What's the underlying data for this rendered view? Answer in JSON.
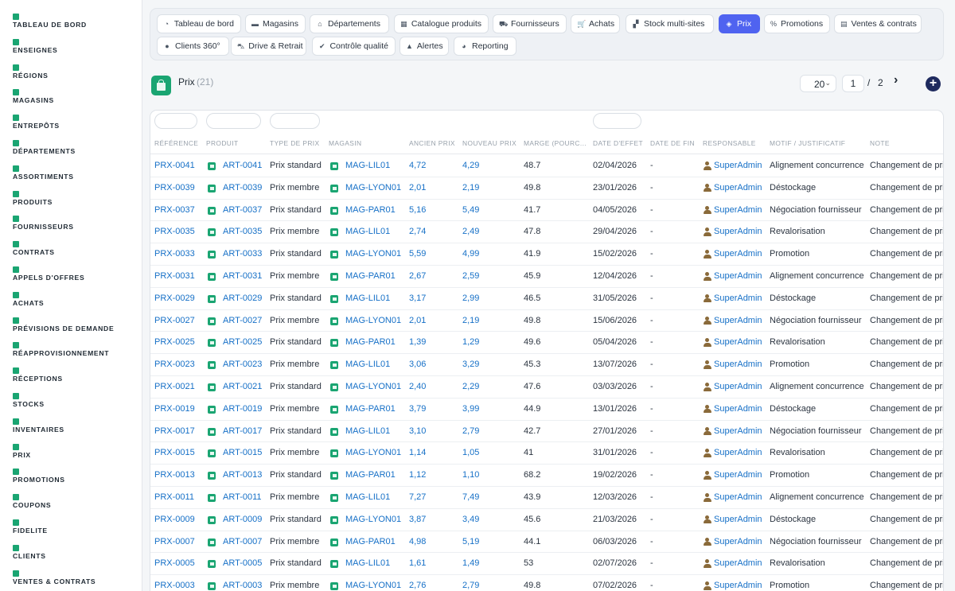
{
  "sidebar": {
    "items": [
      {
        "label": "TABLEAU DE BORD",
        "icon": "dashboard-icon"
      },
      {
        "label": "ENSEIGNES",
        "icon": "flag-icon"
      },
      {
        "label": "RÉGIONS",
        "icon": "map-icon"
      },
      {
        "label": "MAGASINS",
        "icon": "store-icon"
      },
      {
        "label": "ENTREPÔTS",
        "icon": "warehouse-icon"
      },
      {
        "label": "DÉPARTEMENTS",
        "icon": "sitemap-icon"
      },
      {
        "label": "ASSORTIMENTS",
        "icon": "list-icon"
      },
      {
        "label": "PRODUITS",
        "icon": "box-icon"
      },
      {
        "label": "FOURNISSEURS",
        "icon": "truck-icon"
      },
      {
        "label": "CONTRATS",
        "icon": "file-icon"
      },
      {
        "label": "APPELS D'OFFRES",
        "icon": "gavel-icon"
      },
      {
        "label": "ACHATS",
        "icon": "cart-icon"
      },
      {
        "label": "PRÉVISIONS DE DEMANDE",
        "icon": "chart-icon"
      },
      {
        "label": "RÉAPPROVISIONNEMENT",
        "icon": "sync-icon"
      },
      {
        "label": "RÉCEPTIONS",
        "icon": "dolly-icon"
      },
      {
        "label": "STOCKS",
        "icon": "stock-icon"
      },
      {
        "label": "INVENTAIRES",
        "icon": "clipboard-icon"
      },
      {
        "label": "PRIX",
        "icon": "tag-icon"
      },
      {
        "label": "PROMOTIONS",
        "icon": "percent-icon"
      },
      {
        "label": "COUPONS",
        "icon": "ticket-icon"
      },
      {
        "label": "FIDELITE",
        "icon": "card-icon"
      },
      {
        "label": "CLIENTS",
        "icon": "users-icon"
      },
      {
        "label": "VENTES & CONTRATS",
        "icon": "file-contract-icon"
      }
    ]
  },
  "tabs": [
    {
      "label": "Tableau de bord",
      "icon": "gauge-icon",
      "glyph": "◔",
      "active": false
    },
    {
      "label": "Magasins",
      "icon": "store-icon",
      "glyph": "▬",
      "active": false
    },
    {
      "label": "Départements",
      "icon": "building-icon",
      "glyph": "⌂",
      "active": false
    },
    {
      "label": "Catalogue produits",
      "icon": "grid-icon",
      "glyph": "▦",
      "active": false
    },
    {
      "label": "Fournisseurs",
      "icon": "truck-icon",
      "glyph": "⛟",
      "active": false
    },
    {
      "label": "Achats",
      "icon": "cart-icon",
      "glyph": "🛒",
      "active": false
    },
    {
      "label": "Stock multi-sites",
      "icon": "cubes-icon",
      "glyph": "▞",
      "active": false
    },
    {
      "label": "Prix",
      "icon": "tags-icon",
      "glyph": "◈",
      "active": true
    },
    {
      "label": "Promotions",
      "icon": "percent-icon",
      "glyph": "%",
      "active": false
    },
    {
      "label": "Ventes & contrats",
      "icon": "file-icon",
      "glyph": "▤",
      "active": false
    },
    {
      "label": "Clients 360°",
      "icon": "user-icon",
      "glyph": "●",
      "active": false
    },
    {
      "label": "Drive & Retrait",
      "icon": "car-icon",
      "glyph": "⛍",
      "active": false
    },
    {
      "label": "Contrôle qualité",
      "icon": "check-icon",
      "glyph": "✔",
      "active": false
    },
    {
      "label": "Alertes",
      "icon": "bell-icon",
      "glyph": "▲",
      "active": false
    },
    {
      "label": "Reporting",
      "icon": "pie-icon",
      "glyph": "◕",
      "active": false
    }
  ],
  "page": {
    "title": "Prix",
    "count": "(21)",
    "per_page": "20",
    "current_page": "1",
    "page_separator": "/",
    "total_pages": "2",
    "next_glyph": "›",
    "add_glyph": "+"
  },
  "columns": [
    "RÉFÉRENCE",
    "PRODUIT",
    "TYPE DE PRIX",
    "MAGASIN",
    "ANCIEN PRIX",
    "NOUVEAU PRIX",
    "MARGE (POURC...",
    "DATE D'EFFET",
    "DATE DE FIN",
    "RESPONSABLE",
    "MOTIF / JUSTIFICATIF",
    "NOTE"
  ],
  "rows": [
    {
      "ref": "PRX-0041",
      "produit": "ART-0041",
      "type": "Prix standard",
      "magasin": "MAG-LIL01",
      "ancien": "4,72",
      "nouveau": "4,29",
      "marge": "48.7",
      "effet": "02/04/2026",
      "fin": "-",
      "resp": "SuperAdmin",
      "motif": "Alignement concurrence",
      "note": "Changement de prix"
    },
    {
      "ref": "PRX-0039",
      "produit": "ART-0039",
      "type": "Prix membre",
      "magasin": "MAG-LYON01",
      "ancien": "2,01",
      "nouveau": "2,19",
      "marge": "49.8",
      "effet": "23/01/2026",
      "fin": "-",
      "resp": "SuperAdmin",
      "motif": "Déstockage",
      "note": "Changement de prix"
    },
    {
      "ref": "PRX-0037",
      "produit": "ART-0037",
      "type": "Prix standard",
      "magasin": "MAG-PAR01",
      "ancien": "5,16",
      "nouveau": "5,49",
      "marge": "41.7",
      "effet": "04/05/2026",
      "fin": "-",
      "resp": "SuperAdmin",
      "motif": "Négociation fournisseur",
      "note": "Changement de prix"
    },
    {
      "ref": "PRX-0035",
      "produit": "ART-0035",
      "type": "Prix membre",
      "magasin": "MAG-LIL01",
      "ancien": "2,74",
      "nouveau": "2,49",
      "marge": "47.8",
      "effet": "29/04/2026",
      "fin": "-",
      "resp": "SuperAdmin",
      "motif": "Revalorisation",
      "note": "Changement de prix"
    },
    {
      "ref": "PRX-0033",
      "produit": "ART-0033",
      "type": "Prix standard",
      "magasin": "MAG-LYON01",
      "ancien": "5,59",
      "nouveau": "4,99",
      "marge": "41.9",
      "effet": "15/02/2026",
      "fin": "-",
      "resp": "SuperAdmin",
      "motif": "Promotion",
      "note": "Changement de prix"
    },
    {
      "ref": "PRX-0031",
      "produit": "ART-0031",
      "type": "Prix membre",
      "magasin": "MAG-PAR01",
      "ancien": "2,67",
      "nouveau": "2,59",
      "marge": "45.9",
      "effet": "12/04/2026",
      "fin": "-",
      "resp": "SuperAdmin",
      "motif": "Alignement concurrence",
      "note": "Changement de prix"
    },
    {
      "ref": "PRX-0029",
      "produit": "ART-0029",
      "type": "Prix standard",
      "magasin": "MAG-LIL01",
      "ancien": "3,17",
      "nouveau": "2,99",
      "marge": "46.5",
      "effet": "31/05/2026",
      "fin": "-",
      "resp": "SuperAdmin",
      "motif": "Déstockage",
      "note": "Changement de prix"
    },
    {
      "ref": "PRX-0027",
      "produit": "ART-0027",
      "type": "Prix membre",
      "magasin": "MAG-LYON01",
      "ancien": "2,01",
      "nouveau": "2,19",
      "marge": "49.8",
      "effet": "15/06/2026",
      "fin": "-",
      "resp": "SuperAdmin",
      "motif": "Négociation fournisseur",
      "note": "Changement de prix"
    },
    {
      "ref": "PRX-0025",
      "produit": "ART-0025",
      "type": "Prix standard",
      "magasin": "MAG-PAR01",
      "ancien": "1,39",
      "nouveau": "1,29",
      "marge": "49.6",
      "effet": "05/04/2026",
      "fin": "-",
      "resp": "SuperAdmin",
      "motif": "Revalorisation",
      "note": "Changement de prix"
    },
    {
      "ref": "PRX-0023",
      "produit": "ART-0023",
      "type": "Prix membre",
      "magasin": "MAG-LIL01",
      "ancien": "3,06",
      "nouveau": "3,29",
      "marge": "45.3",
      "effet": "13/07/2026",
      "fin": "-",
      "resp": "SuperAdmin",
      "motif": "Promotion",
      "note": "Changement de prix"
    },
    {
      "ref": "PRX-0021",
      "produit": "ART-0021",
      "type": "Prix standard",
      "magasin": "MAG-LYON01",
      "ancien": "2,40",
      "nouveau": "2,29",
      "marge": "47.6",
      "effet": "03/03/2026",
      "fin": "-",
      "resp": "SuperAdmin",
      "motif": "Alignement concurrence",
      "note": "Changement de prix"
    },
    {
      "ref": "PRX-0019",
      "produit": "ART-0019",
      "type": "Prix membre",
      "magasin": "MAG-PAR01",
      "ancien": "3,79",
      "nouveau": "3,99",
      "marge": "44.9",
      "effet": "13/01/2026",
      "fin": "-",
      "resp": "SuperAdmin",
      "motif": "Déstockage",
      "note": "Changement de prix"
    },
    {
      "ref": "PRX-0017",
      "produit": "ART-0017",
      "type": "Prix standard",
      "magasin": "MAG-LIL01",
      "ancien": "3,10",
      "nouveau": "2,79",
      "marge": "42.7",
      "effet": "27/01/2026",
      "fin": "-",
      "resp": "SuperAdmin",
      "motif": "Négociation fournisseur",
      "note": "Changement de prix"
    },
    {
      "ref": "PRX-0015",
      "produit": "ART-0015",
      "type": "Prix membre",
      "magasin": "MAG-LYON01",
      "ancien": "1,14",
      "nouveau": "1,05",
      "marge": "41",
      "effet": "31/01/2026",
      "fin": "-",
      "resp": "SuperAdmin",
      "motif": "Revalorisation",
      "note": "Changement de prix"
    },
    {
      "ref": "PRX-0013",
      "produit": "ART-0013",
      "type": "Prix standard",
      "magasin": "MAG-PAR01",
      "ancien": "1,12",
      "nouveau": "1,10",
      "marge": "68.2",
      "effet": "19/02/2026",
      "fin": "-",
      "resp": "SuperAdmin",
      "motif": "Promotion",
      "note": "Changement de prix"
    },
    {
      "ref": "PRX-0011",
      "produit": "ART-0011",
      "type": "Prix membre",
      "magasin": "MAG-LIL01",
      "ancien": "7,27",
      "nouveau": "7,49",
      "marge": "43.9",
      "effet": "12/03/2026",
      "fin": "-",
      "resp": "SuperAdmin",
      "motif": "Alignement concurrence",
      "note": "Changement de prix"
    },
    {
      "ref": "PRX-0009",
      "produit": "ART-0009",
      "type": "Prix standard",
      "magasin": "MAG-LYON01",
      "ancien": "3,87",
      "nouveau": "3,49",
      "marge": "45.6",
      "effet": "21/03/2026",
      "fin": "-",
      "resp": "SuperAdmin",
      "motif": "Déstockage",
      "note": "Changement de prix"
    },
    {
      "ref": "PRX-0007",
      "produit": "ART-0007",
      "type": "Prix membre",
      "magasin": "MAG-PAR01",
      "ancien": "4,98",
      "nouveau": "5,19",
      "marge": "44.1",
      "effet": "06/03/2026",
      "fin": "-",
      "resp": "SuperAdmin",
      "motif": "Négociation fournisseur",
      "note": "Changement de prix"
    },
    {
      "ref": "PRX-0005",
      "produit": "ART-0005",
      "type": "Prix standard",
      "magasin": "MAG-LIL01",
      "ancien": "1,61",
      "nouveau": "1,49",
      "marge": "53",
      "effet": "02/07/2026",
      "fin": "-",
      "resp": "SuperAdmin",
      "motif": "Revalorisation",
      "note": "Changement de prix"
    },
    {
      "ref": "PRX-0003",
      "produit": "ART-0003",
      "type": "Prix membre",
      "magasin": "MAG-LYON01",
      "ancien": "2,76",
      "nouveau": "2,79",
      "marge": "49.8",
      "effet": "07/02/2026",
      "fin": "-",
      "resp": "SuperAdmin",
      "motif": "Promotion",
      "note": "Changement de prix"
    }
  ],
  "colors": {
    "accent": "#4f63f0",
    "brand_green": "#1aa572",
    "link": "#1670c7",
    "add_button": "#1e2a5e"
  }
}
